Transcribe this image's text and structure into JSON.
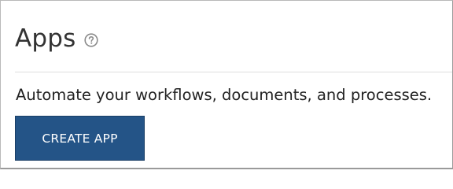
{
  "page": {
    "title": "Apps",
    "help_icon": "question-circle-icon",
    "description": "Automate your workflows, documents, and processes.",
    "create_button_label": "CREATE APP"
  },
  "colors": {
    "button_background": "#245487",
    "button_text": "#ffffff",
    "title_text": "#333333",
    "help_icon": "#8a8a8a",
    "divider": "#dedede"
  }
}
